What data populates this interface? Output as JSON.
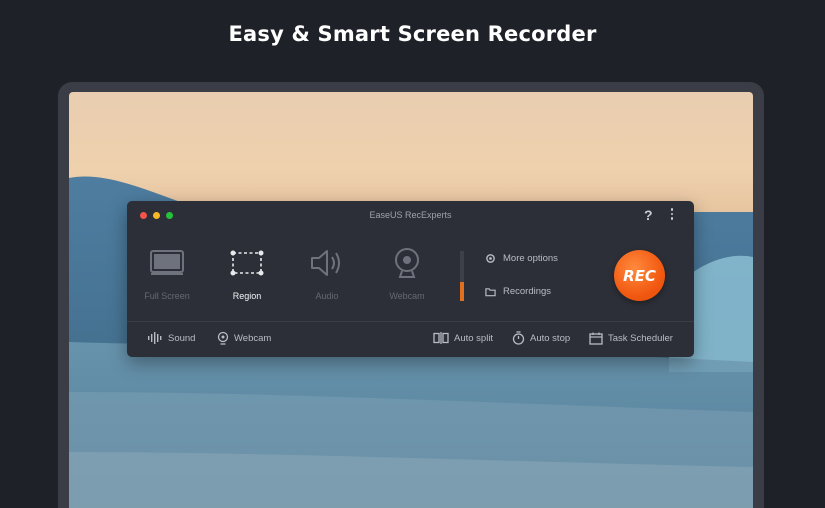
{
  "headline": "Easy & Smart Screen Recorder",
  "app": {
    "title": "EaseUS RecExperts",
    "help_glyph": "?",
    "modes": [
      {
        "label": "Full Screen",
        "icon": "monitor-icon",
        "active": false
      },
      {
        "label": "Region",
        "icon": "region-select-icon",
        "active": true
      },
      {
        "label": "Audio",
        "icon": "speaker-icon",
        "active": false
      },
      {
        "label": "Webcam",
        "icon": "webcam-icon",
        "active": false
      }
    ],
    "audio_level": 0.38,
    "options": {
      "more_options": "More options",
      "recordings": "Recordings"
    },
    "rec_label": "REC",
    "bottom_left": {
      "sound": "Sound",
      "webcam": "Webcam"
    },
    "bottom_right": {
      "auto_split": "Auto split",
      "auto_stop": "Auto stop",
      "task_scheduler": "Task Scheduler"
    }
  },
  "colors": {
    "background": "#1f2128",
    "app_panel": "#2c2f37",
    "rec_button": "#f25a12",
    "level_fill": "#e0701f"
  }
}
